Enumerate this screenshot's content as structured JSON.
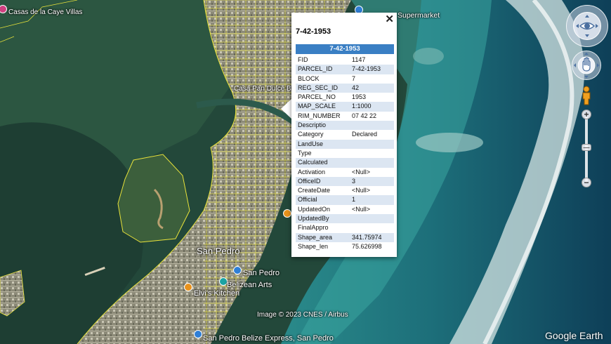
{
  "map": {
    "place_labels": {
      "casas": "Casas de la Caye Villas",
      "supermarket": "Supermarket",
      "casa_pan_dulce": "Casa Pan Dulce B",
      "san_pedro_town": "San Pedro",
      "san_pedro_poi": "San Pedro",
      "belizean_arts": "Belizean Arts",
      "elvis_kitchen": "Elvi's Kitchen",
      "express": "San Pedro Belize Express, San Pedro"
    },
    "attribution": "Image © 2023 CNES / Airbus",
    "brand": "Google Earth"
  },
  "popup": {
    "close_glyph": "✕",
    "title": "7-42-1953",
    "header": "7-42-1953",
    "rows": [
      {
        "key": "FID",
        "value": "1147"
      },
      {
        "key": "PARCEL_ID",
        "value": "7-42-1953"
      },
      {
        "key": "BLOCK",
        "value": "7"
      },
      {
        "key": "REG_SEC_ID",
        "value": "42"
      },
      {
        "key": "PARCEL_NO",
        "value": "1953"
      },
      {
        "key": "MAP_SCALE",
        "value": "1:1000"
      },
      {
        "key": "RIM_NUMBER",
        "value": "07 42 22"
      },
      {
        "key": "Descriptio",
        "value": ""
      },
      {
        "key": "Category",
        "value": "Declared"
      },
      {
        "key": "LandUse",
        "value": ""
      },
      {
        "key": "Type",
        "value": ""
      },
      {
        "key": "Calculated",
        "value": ""
      },
      {
        "key": "Activation",
        "value": "<Null>"
      },
      {
        "key": "OfficeID",
        "value": "3"
      },
      {
        "key": "CreateDate",
        "value": "<Null>"
      },
      {
        "key": "Official",
        "value": "1"
      },
      {
        "key": "UpdatedOn",
        "value": "<Null>"
      },
      {
        "key": "UpdatedBy",
        "value": ""
      },
      {
        "key": "FinalAppro",
        "value": ""
      },
      {
        "key": "Shape_area",
        "value": "341.75974"
      },
      {
        "key": "Shape_len",
        "value": "75.626998"
      }
    ]
  },
  "controls": {
    "zoom_in": "+",
    "zoom_out": "−",
    "icons": [
      "look-around-icon",
      "pan-hand-icon",
      "street-view-pegman-icon",
      "zoom-in-icon",
      "zoom-out-icon"
    ]
  },
  "colors": {
    "parcel_outline": "#e8e23a",
    "popup_header": "#3a7fc4",
    "row_alt": "#dce6f2"
  }
}
